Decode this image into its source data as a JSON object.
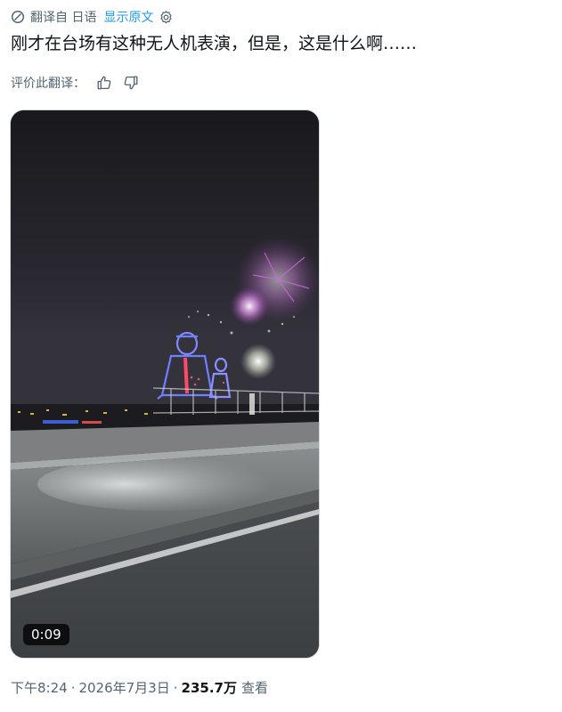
{
  "translation": {
    "from_label": "翻译自 日语",
    "show_original": "显示原文"
  },
  "post": {
    "text": "刚才在台场有这种无人机表演，但是，这是什么啊……"
  },
  "rate": {
    "label": "评价此翻译："
  },
  "media": {
    "duration": "0:09"
  },
  "meta": {
    "time": "下午8:24",
    "separator": "·",
    "date": "2026年7月3日",
    "views_count": "235.7万",
    "views_label": "查看"
  },
  "colors": {
    "text_primary": "#0f1419",
    "text_secondary": "#536471",
    "link_blue": "#1d9bf0"
  },
  "icons": {
    "translate": "translate-icon",
    "settings": "gear-icon",
    "thumbs_up": "thumbs-up-icon",
    "thumbs_down": "thumbs-down-icon"
  }
}
